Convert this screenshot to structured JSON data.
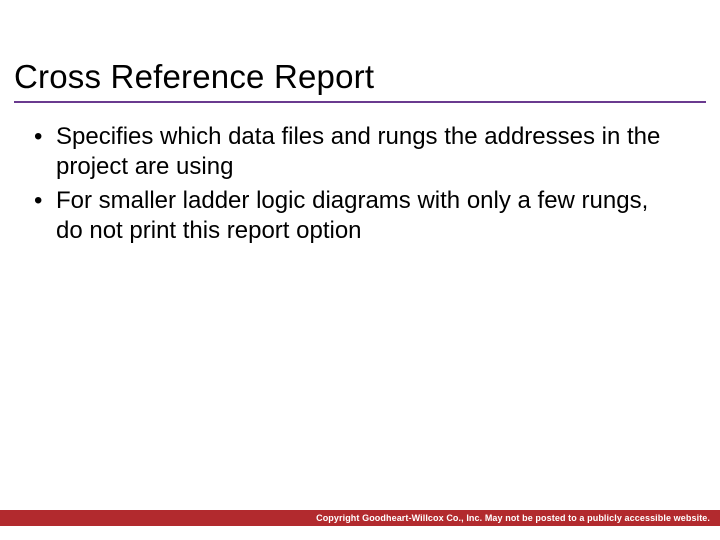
{
  "title": "Cross Reference Report",
  "bullets": [
    "Specifies which data files and rungs the addresses in the project are using",
    "For smaller ladder logic diagrams with only a few rungs, do not print this report option"
  ],
  "footer": "Copyright Goodheart-Willcox Co., Inc.  May not be posted to a publicly accessible website."
}
